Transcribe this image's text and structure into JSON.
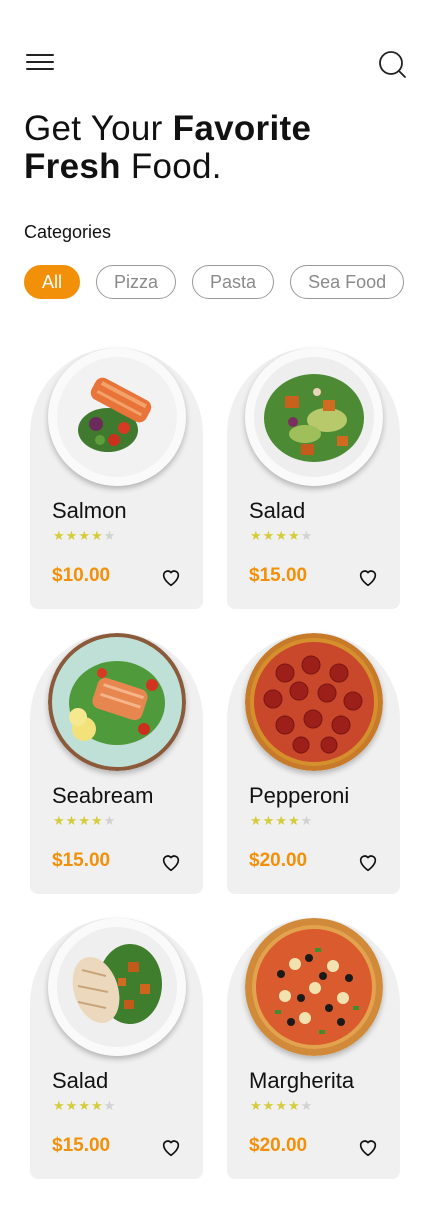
{
  "header": {
    "headline_part1": "Get Your ",
    "headline_bold1": "Favorite",
    "headline_bold2": "Fresh",
    "headline_part2": " Food."
  },
  "categories": {
    "title": "Categories",
    "chips": [
      "All",
      "Pizza",
      "Pasta",
      "Sea Food"
    ],
    "active": "All"
  },
  "colors": {
    "accent": "#f39009",
    "card_bg": "#f0f0f0",
    "star_on": "#d4cc3a",
    "star_off": "#d2d2d2"
  },
  "foods": [
    {
      "name": "Salmon",
      "rating": 4,
      "max_rating": 5,
      "price": "$10.00",
      "image": "salmon-plate"
    },
    {
      "name": "Salad",
      "rating": 4,
      "max_rating": 5,
      "price": "$15.00",
      "image": "salad-plate"
    },
    {
      "name": "Seabream",
      "rating": 4,
      "max_rating": 5,
      "price": "$15.00",
      "image": "seabream-plate"
    },
    {
      "name": "Pepperoni",
      "rating": 4,
      "max_rating": 5,
      "price": "$20.00",
      "image": "pepperoni-pizza"
    },
    {
      "name": "Salad",
      "rating": 4,
      "max_rating": 5,
      "price": "$15.00",
      "image": "chicken-salad-plate"
    },
    {
      "name": "Margherita",
      "rating": 4,
      "max_rating": 5,
      "price": "$20.00",
      "image": "margherita-pizza"
    }
  ]
}
